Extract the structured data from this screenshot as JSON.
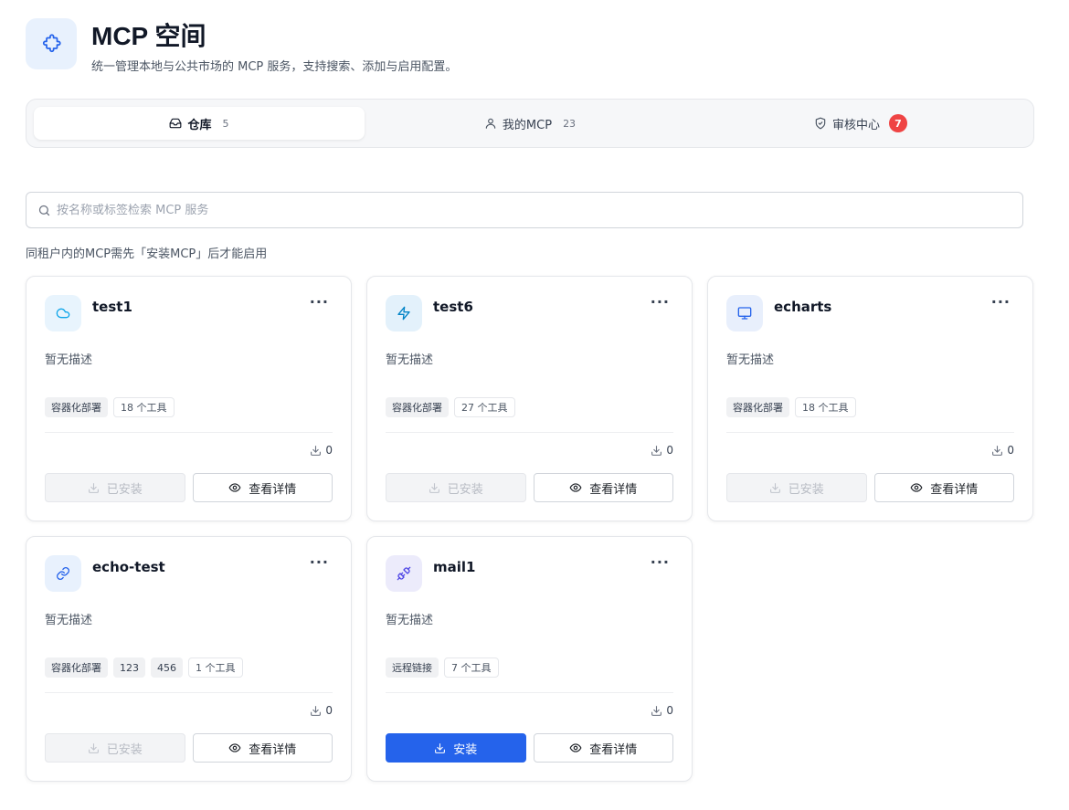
{
  "header": {
    "title": "MCP 空间",
    "subtitle": "统一管理本地与公共市场的 MCP 服务，支持搜索、添加与启用配置。",
    "icon": "puzzle-icon"
  },
  "tabs": [
    {
      "label": "仓库",
      "count": "5",
      "icon": "inbox-icon",
      "active": true
    },
    {
      "label": "我的MCP",
      "count": "23",
      "icon": "user-icon",
      "active": false
    },
    {
      "label": "审核中心",
      "badge": "7",
      "icon": "shield-check-icon",
      "active": false
    }
  ],
  "search": {
    "placeholder": "按名称或标签检索 MCP 服务"
  },
  "hint": "同租户内的MCP需先「安装MCP」后才能启用",
  "labels": {
    "installed": "已安装",
    "install": "安装",
    "details": "查看详情",
    "more": "···"
  },
  "cards": [
    {
      "title": "test1",
      "desc": "暂无描述",
      "icon": "cloud-icon",
      "tags": [
        "容器化部署"
      ],
      "tools": "18 个工具",
      "downloads": "0",
      "installed": true
    },
    {
      "title": "test6",
      "desc": "暂无描述",
      "icon": "zap-icon",
      "tags": [
        "容器化部署"
      ],
      "tools": "27 个工具",
      "downloads": "0",
      "installed": true
    },
    {
      "title": "echarts",
      "desc": "暂无描述",
      "icon": "monitor-icon",
      "tags": [
        "容器化部署"
      ],
      "tools": "18 个工具",
      "downloads": "0",
      "installed": true
    },
    {
      "title": "echo-test",
      "desc": "暂无描述",
      "icon": "link-icon",
      "tags": [
        "容器化部署",
        "123",
        "456"
      ],
      "tools": "1 个工具",
      "downloads": "0",
      "installed": true
    },
    {
      "title": "mail1",
      "desc": "暂无描述",
      "icon": "plug-icon",
      "tags": [
        "远程链接"
      ],
      "tools": "7 个工具",
      "downloads": "0",
      "installed": false
    }
  ],
  "colors": {
    "primary": "#2563eb",
    "badge": "#ef4444",
    "icon_bg": "#e8f1fd"
  }
}
